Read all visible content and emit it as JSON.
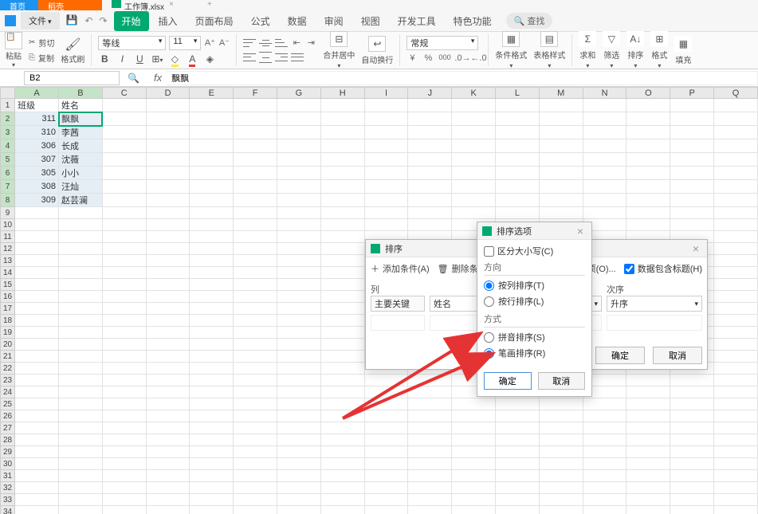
{
  "tabs": {
    "home": "首页",
    "orange": "稻壳",
    "doc": "工作簿.xlsx",
    "close": "×",
    "add": "+"
  },
  "menu": {
    "file": "文件",
    "arrow": "▾",
    "items": [
      "开始",
      "插入",
      "页面布局",
      "公式",
      "数据",
      "审阅",
      "视图",
      "开发工具",
      "特色功能"
    ],
    "search": "查找"
  },
  "toolbar": {
    "paste": "粘贴",
    "cut": "剪切",
    "copy": "复制",
    "fmtpainter": "格式刷",
    "font": "等线",
    "size": "11",
    "merge": "合并居中",
    "wrap": "自动换行",
    "numfmt": "常规",
    "condfmt": "条件格式",
    "tblstyle": "表格样式",
    "sum": "求和",
    "filter": "筛选",
    "sort": "排序",
    "format": "格式",
    "fill": "填充",
    "drop": "▾"
  },
  "namebox": {
    "cell": "B2"
  },
  "formula": {
    "value": "飘飘"
  },
  "grid": {
    "cols": [
      "A",
      "B",
      "C",
      "D",
      "E",
      "F",
      "G",
      "H",
      "I",
      "J",
      "K",
      "L",
      "M",
      "N",
      "O",
      "P",
      "Q"
    ],
    "header": [
      "班级",
      "姓名"
    ],
    "rows": [
      [
        "311",
        "飘飘"
      ],
      [
        "310",
        "李茜"
      ],
      [
        "306",
        "长成"
      ],
      [
        "307",
        "沈薇"
      ],
      [
        "305",
        "小小"
      ],
      [
        "308",
        "汪灿"
      ],
      [
        "309",
        "赵芸澜"
      ]
    ]
  },
  "sort_dialog": {
    "title": "排序",
    "add_cond": "添加条件(A)",
    "del_cond": "删除条件(",
    "options": "选项(O)...",
    "has_header": "数据包含标题(H)",
    "col_hdr": "列",
    "order_hdr": "次序",
    "key_lbl": "主要关键",
    "key_val": "姓名",
    "order_val": "升序",
    "ok": "确定",
    "cancel": "取消"
  },
  "opts_dialog": {
    "title": "排序选项",
    "case": "区分大小写(C)",
    "dir_label": "方向",
    "dir_col": "按列排序(T)",
    "dir_row": "按行排序(L)",
    "method_label": "方式",
    "method_pinyin": "拼音排序(S)",
    "method_stroke": "笔画排序(R)",
    "ok": "确定",
    "cancel": "取消"
  }
}
